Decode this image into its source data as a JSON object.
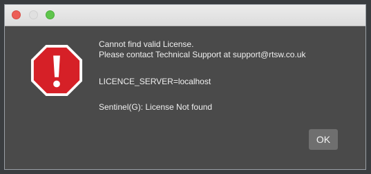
{
  "dialog": {
    "line1": "Cannot find valid License.",
    "line2": "Please contact Technical Support at support@rtsw.co.uk",
    "server_line": "LICENCE_SERVER=localhost",
    "status_line": "Sentinel(G): License Not found",
    "ok_label": "OK"
  },
  "colors": {
    "dialog_bg": "#4a4a4a",
    "alert_red": "#d62027"
  },
  "icons": {
    "alert": "stop-octagon-exclamation-icon"
  }
}
